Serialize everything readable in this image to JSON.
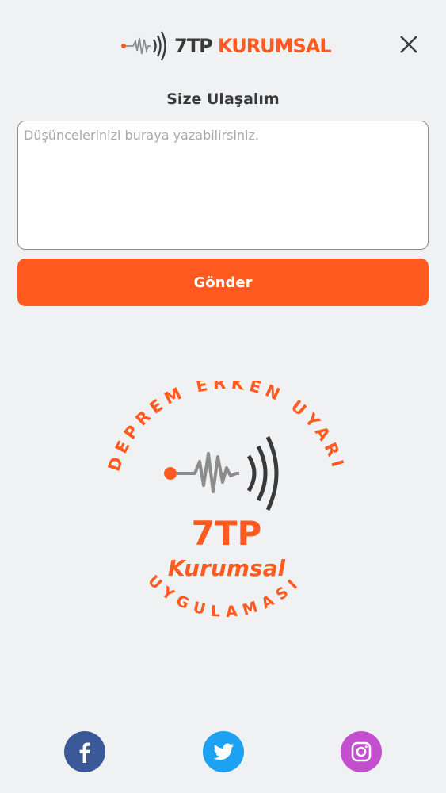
{
  "header": {
    "brand_prefix": "7TP",
    "brand_suffix": "KURUMSAL",
    "close_icon": "close-icon"
  },
  "contact": {
    "title": "Size Ulaşalım",
    "placeholder": "Düşüncelerinizi buraya yazabilirsiniz.",
    "value": "",
    "send_label": "Gönder"
  },
  "emblem": {
    "top_arc_text": "DEPREM ERKEN UYARI",
    "main": "7TP",
    "sub": "Kurumsal",
    "bottom_arc_text": "UYGULAMASI"
  },
  "social": [
    {
      "name": "facebook",
      "icon": "facebook-icon",
      "color": "#3b5998"
    },
    {
      "name": "twitter",
      "icon": "twitter-icon",
      "color": "#1da1f2"
    },
    {
      "name": "instagram",
      "icon": "instagram-icon",
      "color": "#c44fce"
    }
  ],
  "colors": {
    "accent": "#ff5a1f",
    "dark_text": "#3a3a3a",
    "background": "#f0f1f3"
  }
}
